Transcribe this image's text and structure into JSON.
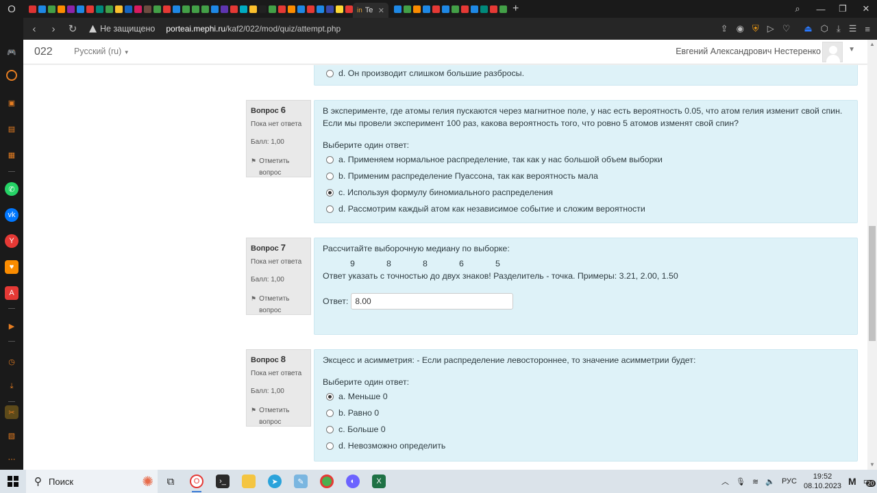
{
  "browser": {
    "active_tab_title": "Te",
    "security_label": "Не защищено",
    "url_domain": "porteai.mephi.ru",
    "url_path": "/kaf2/022/mod/quiz/attempt.php",
    "favicon_colors": [
      "#d33",
      "#1e88e5",
      "#43a047",
      "#fb8c00",
      "#8e24aa",
      "#1e88e5",
      "#e53935",
      "#00897b",
      "#43a047",
      "#fbc02d",
      "#1565c0",
      "#d81b60",
      "#6d4c41",
      "#43a047",
      "#e53935",
      "#1e88e5",
      "#43a047",
      "#43a047",
      "#43a047",
      "#1e88e5",
      "#5e35b1",
      "#e53935",
      "#00acc1",
      "#fbc02d",
      "#212121",
      "#43a047",
      "#e53935",
      "#fb8c00",
      "#1e88e5",
      "#e53935",
      "#1e88e5",
      "#3949ab",
      "#fdd835",
      "#e53935",
      "#1e88e5",
      "#43a047",
      "#fb8c00",
      "#1e88e5",
      "#e53935",
      "#1e88e5",
      "#43a047",
      "#e53935",
      "#1e88e5",
      "#00897b",
      "#e53935",
      "#43a047"
    ]
  },
  "header": {
    "course": "022",
    "language": "Русский (ru)",
    "user_name": "Евгений Александрович Нестеренко"
  },
  "prev_question": {
    "option_d": "d. Он производит слишком большие разбросы."
  },
  "questions": [
    {
      "label": "Вопрос",
      "number": "6",
      "status": "Пока нет ответа",
      "points": "Балл: 1,00",
      "flag_line1": "Отметить",
      "flag_line2": "вопрос",
      "text": "В эксперименте, где атомы гелия пускаются через магнитное поле, у нас есть вероятность 0.05, что атом гелия изменит свой спин. Если мы провели эксперимент 100 раз, какова вероятность того, что ровно 5 атомов изменят свой спин?",
      "choose": "Выберите один ответ:",
      "options": [
        {
          "text": "a. Применяем нормальное распределение, так как у нас большой объем выборки",
          "selected": false
        },
        {
          "text": "b. Применим распределение Пуассона, так как вероятность мала",
          "selected": false
        },
        {
          "text": "c. Используя формулу биномиального распределения",
          "selected": true
        },
        {
          "text": "d. Рассмотрим каждый атом как независимое событие и сложим вероятности",
          "selected": false
        }
      ]
    },
    {
      "label": "Вопрос",
      "number": "7",
      "status": "Пока нет ответа",
      "points": "Балл: 1,00",
      "flag_line1": "Отметить",
      "flag_line2": "вопрос",
      "text": "Рассчитайте выборочную медиану по выборке:",
      "sample": [
        "9",
        "8",
        "8",
        "6",
        "5"
      ],
      "instruction": "Ответ указать с точностью до двух знаков! Разделитель - точка. Примеры: 3.21, 2.00, 1.50",
      "answer_label": "Ответ:",
      "answer_value": "8.00"
    },
    {
      "label": "Вопрос",
      "number": "8",
      "status": "Пока нет ответа",
      "points": "Балл: 1,00",
      "flag_line1": "Отметить",
      "flag_line2": "вопрос",
      "text": "Эксцесс и асимметрия: - Если распределение левостороннее, то значение асимметрии будет:",
      "choose": "Выберите один ответ:",
      "options": [
        {
          "text": "a. Меньше 0",
          "selected": true
        },
        {
          "text": "b. Равно 0",
          "selected": false
        },
        {
          "text": "c. Больше 0",
          "selected": false
        },
        {
          "text": "d. Невозможно определить",
          "selected": false
        }
      ]
    }
  ],
  "taskbar": {
    "search_label": "Поиск",
    "language": "РУС",
    "time": "19:52",
    "date": "08.10.2023",
    "notifications": "20"
  }
}
